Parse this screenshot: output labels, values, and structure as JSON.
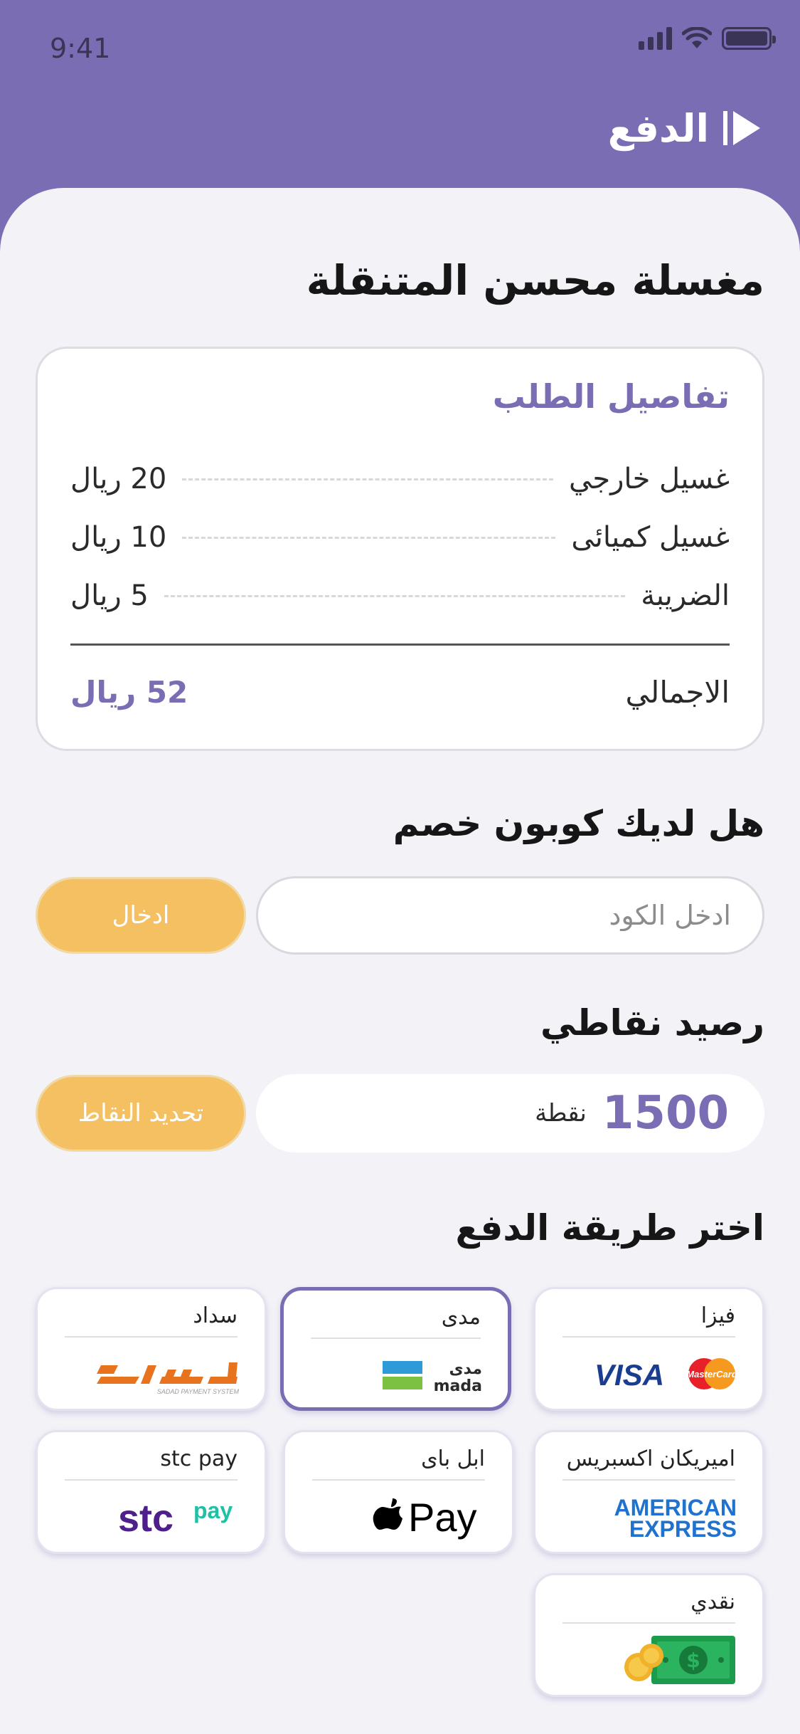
{
  "status_bar": {
    "time": "9:41"
  },
  "header": {
    "title": "الدفع"
  },
  "shop": {
    "name": "مغسلة محسن المتنقلة"
  },
  "order": {
    "title": "تفاصيل الطلب",
    "items": [
      {
        "name": "غسيل خارجي",
        "price": "20 ريال"
      },
      {
        "name": "غسيل كميائى",
        "price": "10 ريال"
      },
      {
        "name": "الضريبة",
        "price": "5 ريال"
      }
    ],
    "total_label": "الاجمالي",
    "total_value": "52 ريال"
  },
  "coupon": {
    "title": "هل لديك كوبون خصم",
    "placeholder": "ادخل الكود",
    "button_label": "ادخال"
  },
  "points": {
    "title": "رصيد نقاطي",
    "value": "1500",
    "unit": "نقطة",
    "button_label": "تحديد النقاط"
  },
  "payment": {
    "title": "اختر طريقة الدفع",
    "methods": [
      {
        "label": "فيزا",
        "logo": "visa-mastercard-logo"
      },
      {
        "label": "مدى",
        "logo": "mada-logo",
        "selected": true
      },
      {
        "label": "سداد",
        "logo": "sadad-logo"
      },
      {
        "label": "اميريكان اكسبريس",
        "logo": "amex-logo"
      },
      {
        "label": "ابل باى",
        "logo": "apple-pay-logo"
      },
      {
        "label": "stc pay",
        "logo": "stc-pay-logo"
      },
      {
        "label": "نقدي",
        "logo": "cash-logo"
      }
    ],
    "logo_text": {
      "visa": "VISA",
      "mastercard": "MasterCard",
      "mada_ar": "مدى",
      "mada_en": "mada",
      "sadad_sub": "SADAD PAYMENT SYSTEM",
      "amex_1": "AMERICAN",
      "amex_2": "EXPRESS",
      "apple_pay": "Pay",
      "stc": "stc",
      "stc_pay": "pay"
    }
  },
  "colors": {
    "primary": "#7a6db3",
    "accent": "#f5c062",
    "background": "#f3f2f7"
  }
}
